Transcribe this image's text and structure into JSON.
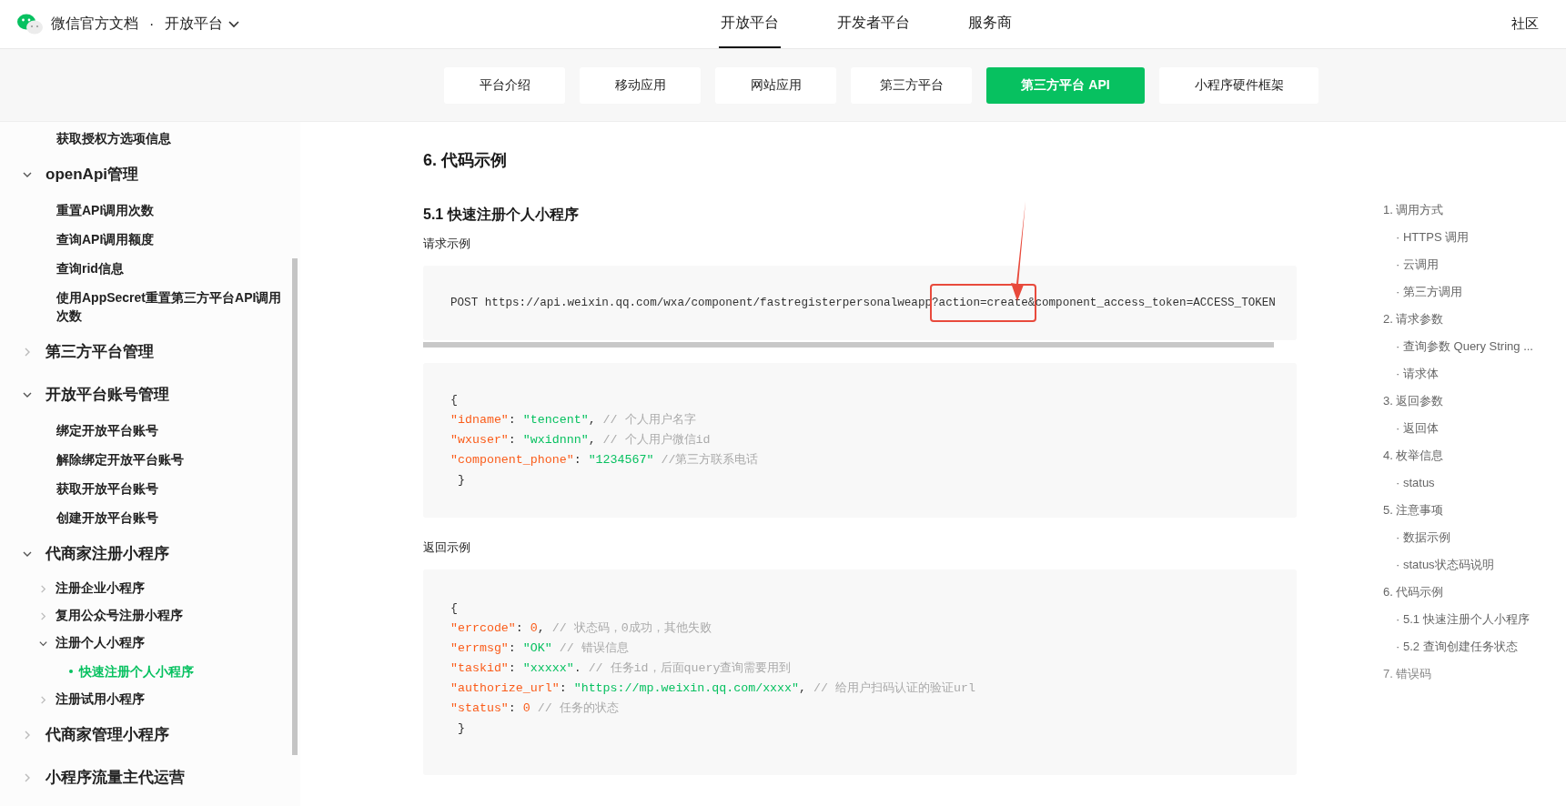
{
  "header": {
    "brand": "微信官方文档",
    "separator": "·",
    "section": "开放平台",
    "community": "社区"
  },
  "nav_tabs": [
    {
      "label": "开放平台",
      "selected": true
    },
    {
      "label": "开发者平台",
      "selected": false
    },
    {
      "label": "服务商",
      "selected": false
    }
  ],
  "sub_tabs": [
    {
      "label": "平台介绍",
      "selected": false
    },
    {
      "label": "移动应用",
      "selected": false
    },
    {
      "label": "网站应用",
      "selected": false
    },
    {
      "label": "第三方平台",
      "selected": false
    },
    {
      "label": "第三方平台 API",
      "selected": true
    },
    {
      "label": "小程序硬件框架",
      "selected": false
    }
  ],
  "sidebar": {
    "items": [
      {
        "kind": "leaf",
        "label": "获取授权方选项信息",
        "selected": false
      },
      {
        "kind": "group",
        "label": "openApi管理",
        "expanded": true,
        "children": [
          {
            "kind": "leaf",
            "label": "重置API调用次数",
            "selected": false
          },
          {
            "kind": "leaf",
            "label": "查询API调用额度",
            "selected": false
          },
          {
            "kind": "leaf",
            "label": "查询rid信息",
            "selected": false
          },
          {
            "kind": "leaf",
            "label": "使用AppSecret重置第三方平台API调用次数",
            "selected": false
          }
        ]
      },
      {
        "kind": "group",
        "label": "第三方平台管理",
        "expanded": false
      },
      {
        "kind": "group",
        "label": "开放平台账号管理",
        "expanded": true,
        "children": [
          {
            "kind": "leaf",
            "label": "绑定开放平台账号",
            "selected": false
          },
          {
            "kind": "leaf",
            "label": "解除绑定开放平台账号",
            "selected": false
          },
          {
            "kind": "leaf",
            "label": "获取开放平台账号",
            "selected": false
          },
          {
            "kind": "leaf",
            "label": "创建开放平台账号",
            "selected": false
          }
        ]
      },
      {
        "kind": "group",
        "label": "代商家注册小程序",
        "expanded": true,
        "children": [
          {
            "kind": "subgroup",
            "label": "注册企业小程序",
            "expanded": false
          },
          {
            "kind": "subgroup",
            "label": "复用公众号注册小程序",
            "expanded": false
          },
          {
            "kind": "subgroup",
            "label": "注册个人小程序",
            "expanded": true,
            "children": [
              {
                "kind": "leaf",
                "label": "快速注册个人小程序",
                "selected": true
              }
            ]
          },
          {
            "kind": "subgroup",
            "label": "注册试用小程序",
            "expanded": false
          }
        ]
      },
      {
        "kind": "group",
        "label": "代商家管理小程序",
        "expanded": false
      },
      {
        "kind": "group",
        "label": "小程序流量主代运营",
        "expanded": false
      }
    ]
  },
  "content": {
    "heading": "6. 代码示例",
    "subheading": "5.1 快速注册个人小程序",
    "request_label": "请求示例",
    "request_line": [
      {
        "text": "POST https://api.weixin.qq.com/wxa/component/fastregisterpersonalweapp",
        "highlighted": false
      },
      {
        "text": "?action=create&",
        "highlighted": true
      },
      {
        "text": "component_access_token=ACCESS_TOKEN",
        "highlighted": false
      }
    ],
    "request_body": [
      [
        {
          "kind": "plain",
          "text": "{"
        }
      ],
      [
        {
          "kind": "key",
          "text": "\"idname\""
        },
        {
          "kind": "plain",
          "text": ": "
        },
        {
          "kind": "str",
          "text": "\"tencent\""
        },
        {
          "kind": "plain",
          "text": ","
        },
        {
          "kind": "comment",
          "text": "// 个人用户名字"
        }
      ],
      [
        {
          "kind": "key",
          "text": "\"wxuser\""
        },
        {
          "kind": "plain",
          "text": ": "
        },
        {
          "kind": "str",
          "text": "\"wxidnnn\""
        },
        {
          "kind": "plain",
          "text": ","
        },
        {
          "kind": "comment",
          "text": "// 个人用户微信id"
        }
      ],
      [
        {
          "kind": "key",
          "text": "\"component_phone\""
        },
        {
          "kind": "plain",
          "text": ": "
        },
        {
          "kind": "str",
          "text": "\"1234567\""
        },
        {
          "kind": "comment",
          "text": "//第三方联系电话"
        }
      ],
      [
        {
          "kind": "plain",
          "text": " }"
        }
      ]
    ],
    "response_label": "返回示例",
    "response_body": [
      [
        {
          "kind": "plain",
          "text": "{"
        }
      ],
      [
        {
          "kind": "key",
          "text": "\"errcode\""
        },
        {
          "kind": "plain",
          "text": ": "
        },
        {
          "kind": "num",
          "text": "0"
        },
        {
          "kind": "plain",
          "text": ","
        },
        {
          "kind": "comment",
          "text": "// 状态码，0成功，其他失败"
        }
      ],
      [
        {
          "kind": "key",
          "text": "\"errmsg\""
        },
        {
          "kind": "plain",
          "text": ": "
        },
        {
          "kind": "str",
          "text": "\"OK\""
        },
        {
          "kind": "comment",
          "text": "// 错误信息"
        }
      ],
      [
        {
          "kind": "key",
          "text": "\"taskid\""
        },
        {
          "kind": "plain",
          "text": ": "
        },
        {
          "kind": "str",
          "text": "\"xxxxx\""
        },
        {
          "kind": "plain",
          "text": "."
        },
        {
          "kind": "comment",
          "text": "// 任务id，后面query查询需要用到"
        }
      ],
      [
        {
          "kind": "key",
          "text": "\"authorize_url\""
        },
        {
          "kind": "plain",
          "text": ": "
        },
        {
          "kind": "str",
          "text": "\"https://mp.weixin.qq.com/xxxx\""
        },
        {
          "kind": "plain",
          "text": ","
        },
        {
          "kind": "comment",
          "text": "// 给用户扫码认证的验证url"
        }
      ],
      [
        {
          "kind": "key",
          "text": "\"status\""
        },
        {
          "kind": "plain",
          "text": ": "
        },
        {
          "kind": "num",
          "text": "0"
        },
        {
          "kind": "comment",
          "text": "// 任务的状态"
        }
      ],
      [
        {
          "kind": "plain",
          "text": " }"
        }
      ]
    ]
  },
  "toc": [
    {
      "label": "1. 调用方式",
      "children": [
        "· HTTPS 调用",
        "· 云调用",
        "· 第三方调用"
      ]
    },
    {
      "label": "2. 请求参数",
      "children": [
        "· 查询参数 Query String ...",
        "· 请求体"
      ]
    },
    {
      "label": "3. 返回参数",
      "children": [
        "· 返回体"
      ]
    },
    {
      "label": "4. 枚举信息",
      "children": [
        "· status"
      ]
    },
    {
      "label": "5. 注意事项",
      "children": [
        "· 数据示例",
        "· status状态码说明"
      ]
    },
    {
      "label": "6. 代码示例",
      "children": [
        "· 5.1 快速注册个人小程序",
        "· 5.2 查询创建任务状态"
      ]
    },
    {
      "label": "7. 错误码"
    }
  ]
}
